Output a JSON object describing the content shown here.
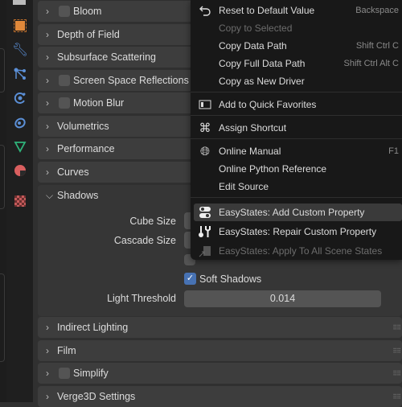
{
  "panels": [
    {
      "label": "Bloom",
      "checkbox": true,
      "expanded": false
    },
    {
      "label": "Depth of Field",
      "checkbox": false,
      "expanded": false
    },
    {
      "label": "Subsurface Scattering",
      "checkbox": false,
      "expanded": false
    },
    {
      "label": "Screen Space Reflections",
      "checkbox": true,
      "expanded": false
    },
    {
      "label": "Motion Blur",
      "checkbox": true,
      "expanded": false
    },
    {
      "label": "Volumetrics",
      "checkbox": false,
      "expanded": false
    },
    {
      "label": "Performance",
      "checkbox": false,
      "expanded": false
    },
    {
      "label": "Curves",
      "checkbox": false,
      "expanded": false
    },
    {
      "label": "Shadows",
      "checkbox": false,
      "expanded": true
    },
    {
      "label": "Indirect Lighting",
      "checkbox": false,
      "expanded": false
    },
    {
      "label": "Film",
      "checkbox": false,
      "expanded": false
    },
    {
      "label": "Simplify",
      "checkbox": true,
      "expanded": false
    },
    {
      "label": "Verge3D Settings",
      "checkbox": false,
      "expanded": false
    }
  ],
  "shadows": {
    "cube_size_label": "Cube Size",
    "cascade_size_label": "Cascade Size",
    "soft_shadows_label": "Soft Shadows",
    "soft_shadows_checked": true,
    "light_threshold_label": "Light Threshold",
    "light_threshold_value": "0.014"
  },
  "menu": {
    "items": [
      {
        "label": "Reset to Default Value",
        "shortcut": "Backspace",
        "icon": "reset-icon",
        "enabled": true
      },
      {
        "label": "Copy to Selected",
        "shortcut": "",
        "icon": "",
        "enabled": false
      },
      {
        "label": "Copy Data Path",
        "shortcut": "Shift Ctrl C",
        "icon": "",
        "enabled": true
      },
      {
        "label": "Copy Full Data Path",
        "shortcut": "Shift Ctrl Alt C",
        "icon": "",
        "enabled": true
      },
      {
        "label": "Copy as New Driver",
        "shortcut": "",
        "icon": "",
        "enabled": true
      },
      {
        "label": "Add to Quick Favorites",
        "shortcut": "",
        "icon": "quick-favorites-icon",
        "enabled": true
      },
      {
        "label": "Assign Shortcut",
        "shortcut": "",
        "icon": "keyboard-command-icon",
        "enabled": true
      },
      {
        "label": "Online Manual",
        "shortcut": "F1",
        "icon": "globe-icon",
        "enabled": true
      },
      {
        "label": "Online Python Reference",
        "shortcut": "",
        "icon": "",
        "enabled": true
      },
      {
        "label": "Edit Source",
        "shortcut": "",
        "icon": "",
        "enabled": true
      },
      {
        "label": "EasyStates: Add Custom Property",
        "shortcut": "",
        "icon": "toggle-icon",
        "enabled": true,
        "highlighted": true
      },
      {
        "label": "EasyStates: Repair Custom Property",
        "shortcut": "",
        "icon": "tools-icon",
        "enabled": true
      },
      {
        "label": "EasyStates: Apply To All Scene States",
        "shortcut": "",
        "icon": "apply-icon",
        "enabled": false
      }
    ]
  },
  "colors": {
    "accent": "#4772b3",
    "object": "#e0883a",
    "modifier": "#5b8fd6",
    "data": "#2fb37a",
    "material": "#d95f5f"
  }
}
